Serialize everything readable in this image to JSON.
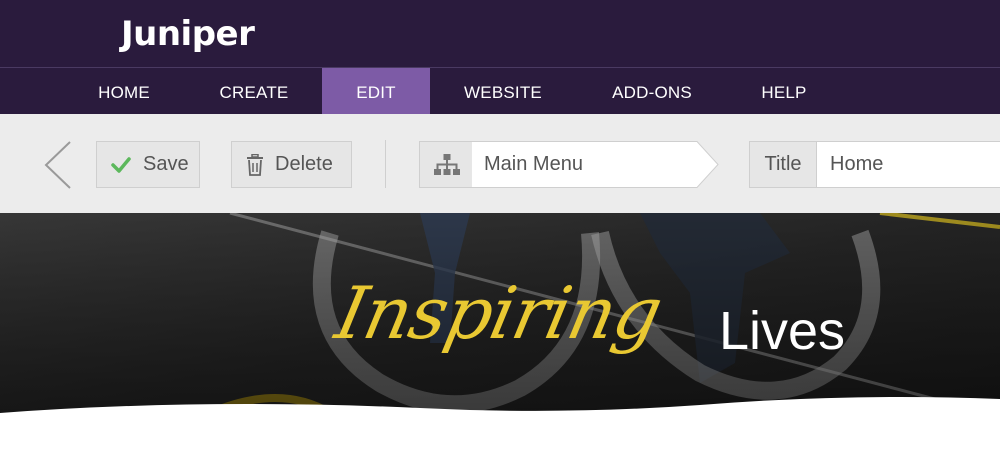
{
  "app": {
    "logo_text": "Juniper"
  },
  "nav": {
    "items": [
      {
        "label": "HOME",
        "active": false
      },
      {
        "label": "CREATE",
        "active": false
      },
      {
        "label": "EDIT",
        "active": true
      },
      {
        "label": "WEBSITE",
        "active": false
      },
      {
        "label": "ADD-ONS",
        "active": false
      },
      {
        "label": "HELP",
        "active": false
      }
    ]
  },
  "toolbar": {
    "save_label": "Save",
    "delete_label": "Delete",
    "menu_select_value": "Main Menu",
    "title_label": "Title",
    "title_value": "Home"
  },
  "hero": {
    "tagline_script": "Inspiring",
    "tagline_plain": "Lives"
  },
  "colors": {
    "header_bg": "#2a1b3d",
    "nav_active": "#7d5ba6",
    "toolbar_bg": "#ececec",
    "save_check": "#5cb85c",
    "tagline_gold": "#e9c832"
  },
  "icons": {
    "back": "chevron-left-icon",
    "save": "check-icon",
    "delete": "trash-icon",
    "menu": "sitemap-icon"
  }
}
